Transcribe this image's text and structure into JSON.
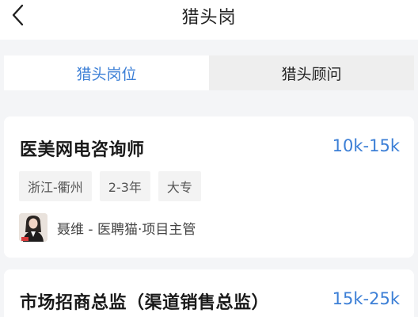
{
  "header": {
    "title": "猎头岗",
    "back_icon": "chevron-left-icon"
  },
  "tabs": [
    {
      "label": "猎头岗位",
      "active": true
    },
    {
      "label": "猎头顾问",
      "active": false
    }
  ],
  "jobs": [
    {
      "title": "医美网电咨询师",
      "salary": "10k-15k",
      "tags": [
        "浙江-衢州",
        "2-3年",
        "大专"
      ],
      "recruiter": "聂维 - 医聘猫·项目主管"
    },
    {
      "title": "市场招商总监（渠道销售总监）",
      "salary": "15k-25k"
    }
  ],
  "colors": {
    "accent": "#3c7fd6",
    "background": "#f4f5f7",
    "tag_bg": "#f3f3f3"
  }
}
